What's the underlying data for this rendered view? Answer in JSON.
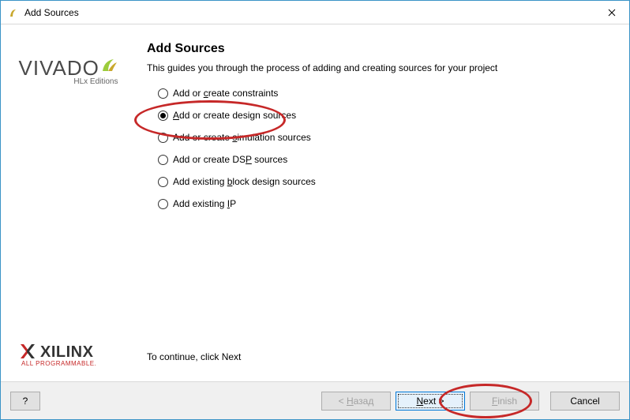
{
  "window": {
    "title": "Add Sources"
  },
  "sidebar": {
    "vivado": "VIVADO",
    "vivado_sub": "HLx Editions",
    "xilinx": "XILINX",
    "xilinx_sub": "ALL PROGRAMMABLE",
    "reg": "."
  },
  "main": {
    "heading": "Add Sources",
    "subtitle": "This guides you through the process of adding and creating sources for your project",
    "options": [
      {
        "pre": "Add or ",
        "u": "c",
        "post": "reate constraints",
        "selected": false
      },
      {
        "pre": "",
        "u": "A",
        "post": "dd or create design sources",
        "selected": true
      },
      {
        "pre": "Add or create ",
        "u": "s",
        "post": "imulation sources",
        "selected": false
      },
      {
        "pre": "Add or create DS",
        "u": "P",
        "post": " sources",
        "selected": false
      },
      {
        "pre": "Add existing ",
        "u": "b",
        "post": "lock design sources",
        "selected": false
      },
      {
        "pre": "Add existing ",
        "u": "I",
        "post": "P",
        "selected": false
      }
    ],
    "continue": "To continue, click Next"
  },
  "buttons": {
    "help": "?",
    "back_pre": "< ",
    "back_u": "Н",
    "back_post": "азад",
    "next_u": "N",
    "next_post": "ext >",
    "finish_u": "F",
    "finish_post": "inish",
    "cancel": "Cancel"
  }
}
